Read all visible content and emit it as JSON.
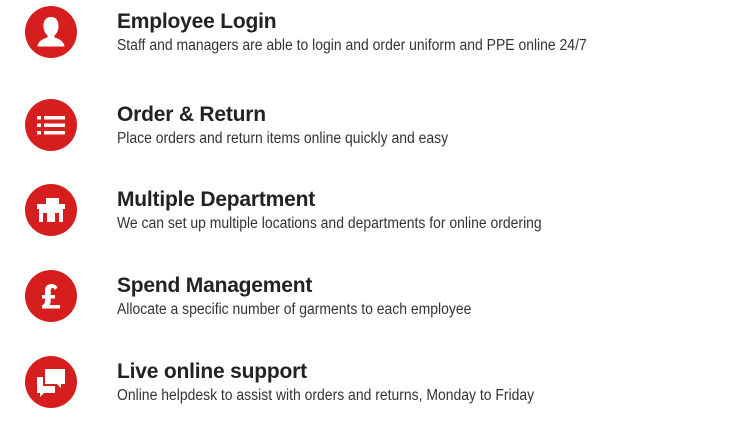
{
  "colors": {
    "accent": "#d71e1e",
    "title_text": "#222222",
    "body_text": "#333333"
  },
  "features": [
    {
      "icon": "user-icon",
      "title": "Employee Login",
      "description": "Staff and managers are able to login and order uniform and PPE online 24/7"
    },
    {
      "icon": "list-icon",
      "title": "Order & Return",
      "description": "Place orders and return items online quickly and easy"
    },
    {
      "icon": "building-icon",
      "title": "Multiple Department",
      "description": "We can set up multiple locations and departments for online ordering"
    },
    {
      "icon": "pound-icon",
      "title": "Spend Management",
      "description": "Allocate a specific number of garments to each employee"
    },
    {
      "icon": "chat-icon",
      "title": "Live online support",
      "description": "Online helpdesk to assist with orders and returns, Monday to Friday"
    }
  ]
}
